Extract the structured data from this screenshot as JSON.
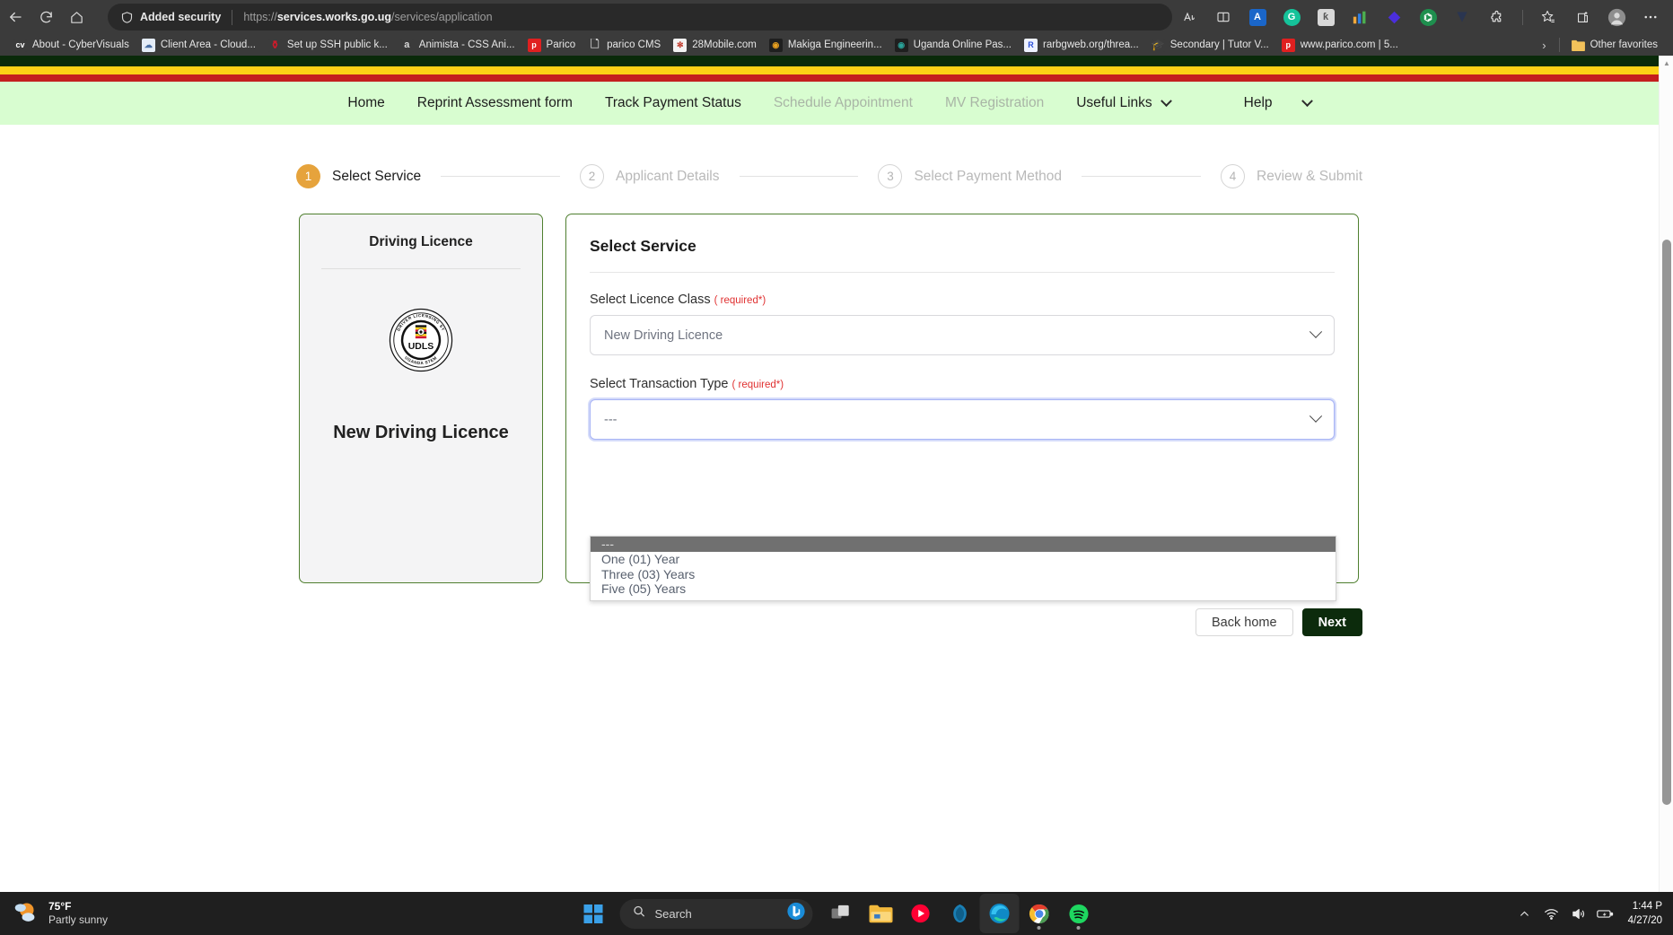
{
  "browser": {
    "back_icon": "back-arrow-icon",
    "reload_icon": "reload-icon",
    "home_icon": "home-icon",
    "security_label": "Added security",
    "url_scheme": "https://",
    "url_host": "services.works.go.ug",
    "url_path": "/services/application",
    "toolbar_icons": [
      {
        "name": "read-aloud-icon",
        "glyph": "Aᴺ"
      },
      {
        "name": "collections-icon",
        "glyph": "☰"
      },
      {
        "name": "translate-icon",
        "glyph": "A"
      },
      {
        "name": "grammarly-icon",
        "glyph": "G"
      },
      {
        "name": "kite-icon",
        "glyph": "ƙ"
      },
      {
        "name": "analytics-icon",
        "glyph": "▌"
      },
      {
        "name": "diamond-extension-icon",
        "glyph": "◆"
      },
      {
        "name": "robot-extension-icon",
        "glyph": "●"
      },
      {
        "name": "vimeo-extension-icon",
        "glyph": "V"
      },
      {
        "name": "extensions-puzzle-icon",
        "glyph": "⚙"
      },
      {
        "name": "favorites-star-icon",
        "glyph": "☆"
      },
      {
        "name": "collections-add-icon",
        "glyph": "❐"
      },
      {
        "name": "profile-avatar-icon",
        "glyph": "●"
      },
      {
        "name": "settings-more-icon",
        "glyph": "⋯"
      }
    ],
    "bookmarks": [
      {
        "label": "About - CyberVisuals",
        "icon_text": "cv",
        "icon_bg": "#3b3b3b",
        "icon_fg": "#ffffff"
      },
      {
        "label": "Client Area - Cloud...",
        "icon_text": "☁",
        "icon_bg": "#e9eef6",
        "icon_fg": "#4a6fa5"
      },
      {
        "label": "Set up SSH public k...",
        "icon_text": "⑂",
        "icon_bg": "#3b3b3b",
        "icon_fg": "#d11a2a"
      },
      {
        "label": "Animista - CSS Ani...",
        "icon_text": "a",
        "icon_bg": "#3b3b3b",
        "icon_fg": "#d8d8d8"
      },
      {
        "label": "Parico",
        "icon_text": "p",
        "icon_bg": "#e02020",
        "icon_fg": "#ffffff"
      },
      {
        "label": "parico CMS",
        "icon_text": "▭",
        "icon_bg": "#3b3b3b",
        "icon_fg": "#cccccc"
      },
      {
        "label": "28Mobile.com",
        "icon_text": "✿",
        "icon_bg": "#f2f2f2",
        "icon_fg": "#c0392b"
      },
      {
        "label": "Makiga Engineerin...",
        "icon_text": "◉",
        "icon_bg": "#2b2b2b",
        "icon_fg": "#e8a020"
      },
      {
        "label": "Uganda Online Pas...",
        "icon_text": "◉",
        "icon_bg": "#2b2b2b",
        "icon_fg": "#2aa39a"
      },
      {
        "label": "rarbgweb.org/threa...",
        "icon_text": "R",
        "icon_bg": "#eef2ff",
        "icon_fg": "#2b50d8"
      },
      {
        "label": "Secondary | Tutor V...",
        "icon_text": "☖",
        "icon_bg": "#3b3b3b",
        "icon_fg": "#ffffff"
      },
      {
        "label": "www.parico.com | 5...",
        "icon_text": "p",
        "icon_bg": "#e02020",
        "icon_fg": "#ffffff"
      }
    ],
    "overflow_chevron": "chevron-right-icon",
    "other_favorites_label": "Other favorites",
    "other_favorites_icon": "folder-icon"
  },
  "site": {
    "flag_colors": {
      "black": "#0a2a0a",
      "yellow": "#fcd116",
      "red": "#c41e1e"
    },
    "nav_bg": "#d8fdd0",
    "nav": [
      {
        "label": "Home",
        "state": "normal",
        "chevron": false
      },
      {
        "label": "Reprint Assessment form",
        "state": "normal",
        "chevron": false
      },
      {
        "label": "Track Payment Status",
        "state": "normal",
        "chevron": false
      },
      {
        "label": "Schedule Appointment",
        "state": "disabled",
        "chevron": false
      },
      {
        "label": "MV Registration",
        "state": "disabled",
        "chevron": false
      },
      {
        "label": "Useful Links",
        "state": "normal",
        "chevron": true
      },
      {
        "label": "Help",
        "state": "normal",
        "chevron": true
      }
    ]
  },
  "stepper": {
    "active_color": "#e6a33c",
    "steps": [
      {
        "num": "1",
        "label": "Select Service",
        "state": "active"
      },
      {
        "num": "2",
        "label": "Applicant Details",
        "state": "idle"
      },
      {
        "num": "3",
        "label": "Select Payment Method",
        "state": "idle"
      },
      {
        "num": "4",
        "label": "Review & Submit",
        "state": "idle"
      }
    ]
  },
  "side_card": {
    "title": "Driving Licence",
    "logo_name": "udls-logo",
    "logo_text_outer": "UGANDA DRIVER LICENSING SYSTEM",
    "logo_text_inner": "UDLS",
    "subtitle": "New Driving Licence"
  },
  "form": {
    "title": "Select Service",
    "licence_class": {
      "label": "Select Licence Class",
      "required_text": "( required*)",
      "value": "New Driving Licence"
    },
    "transaction_type": {
      "label": "Select Transaction Type",
      "required_text": "( required*)",
      "value": "---",
      "options": [
        "---",
        "One (01) Year",
        "Three (03) Years",
        "Five (05) Years"
      ],
      "selected_index": 0
    }
  },
  "actions": {
    "back_label": "Back home",
    "next_label": "Next",
    "next_bg": "#0c2b0c"
  },
  "taskbar": {
    "weather_temp": "75°F",
    "weather_desc": "Partly sunny",
    "weather_icon": "partly-sunny-icon",
    "start_icon": "windows-start-icon",
    "search_placeholder": "Search",
    "search_icon": "search-icon",
    "copilot_icon": "bing-copilot-icon",
    "apps": [
      {
        "name": "task-view-icon",
        "glyph": "❐"
      },
      {
        "name": "file-explorer-icon",
        "glyph": "▤"
      },
      {
        "name": "youtube-music-icon",
        "glyph": "▶"
      },
      {
        "name": "thunderbird-icon",
        "glyph": "✉"
      },
      {
        "name": "microsoft-edge-icon",
        "glyph": "◐"
      },
      {
        "name": "google-chrome-icon",
        "glyph": "●"
      },
      {
        "name": "spotify-icon",
        "glyph": "♫"
      }
    ],
    "tray": [
      {
        "name": "show-hidden-icons-chevron",
        "glyph": "∧"
      },
      {
        "name": "wifi-icon",
        "glyph": "◠"
      },
      {
        "name": "volume-icon",
        "glyph": "◁"
      },
      {
        "name": "battery-icon",
        "glyph": "▭"
      }
    ],
    "clock_time": "1:44 P",
    "clock_date": "4/27/20"
  }
}
